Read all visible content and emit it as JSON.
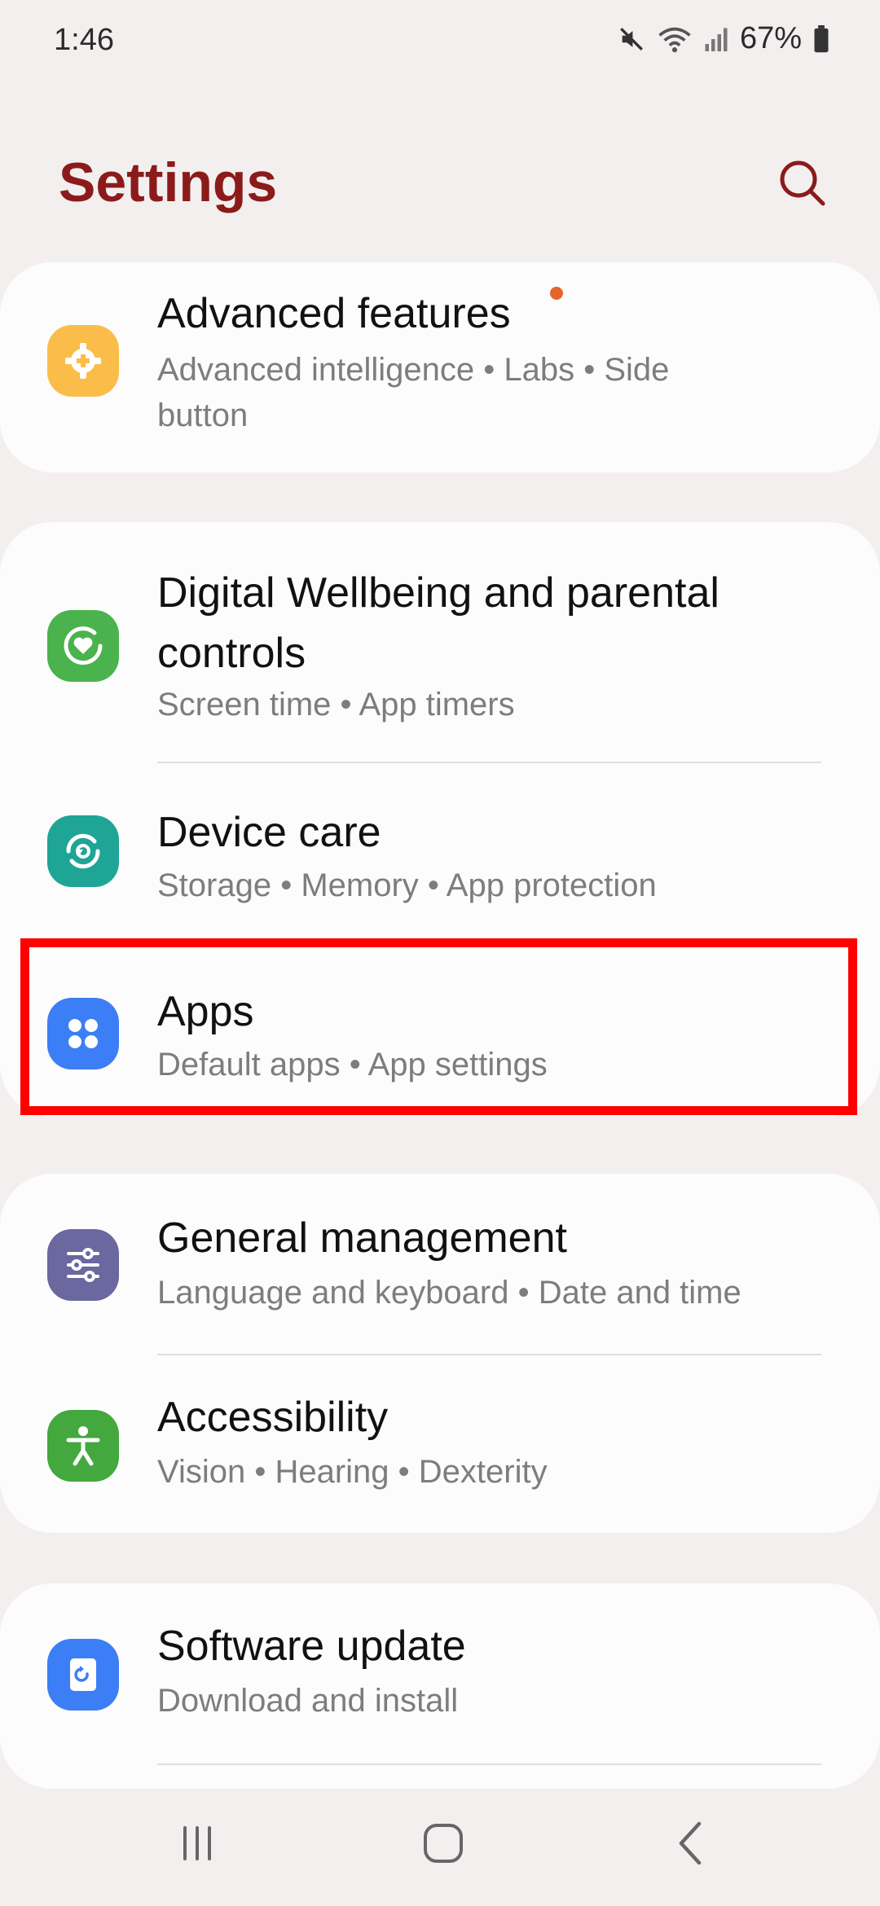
{
  "status_bar": {
    "time": "1:46",
    "battery": "67%",
    "icons": [
      "mute-icon",
      "wifi-icon",
      "signal-icon",
      "battery-icon"
    ]
  },
  "header": {
    "title": "Settings",
    "search_icon": "search-icon"
  },
  "colors": {
    "title": "#8b1b1b",
    "advanced_features_icon": "#fbbd4a",
    "digital_wellbeing_icon": "#4ab34d",
    "device_care_icon": "#1fa596",
    "apps_icon": "#3c7ef5",
    "general_management_icon": "#6b679f",
    "accessibility_icon": "#43a83e",
    "software_update_icon": "#3c7ef5",
    "notification_dot": "#e8642a",
    "highlight": "#ff0000"
  },
  "items": {
    "advanced_features": {
      "title": "Advanced features",
      "subtitle_line1": "Advanced intelligence  •  Labs  •  Side",
      "subtitle_line2": "button",
      "icon": "gear-plus-icon"
    },
    "digital_wellbeing": {
      "title_line1": "Digital Wellbeing and parental",
      "title_line2": "controls",
      "subtitle": "Screen time  •  App timers",
      "icon": "wellbeing-heart-icon"
    },
    "device_care": {
      "title": "Device care",
      "subtitle": "Storage  •  Memory  •  App protection",
      "icon": "device-care-icon"
    },
    "apps": {
      "title": "Apps",
      "subtitle": "Default apps  •  App settings",
      "icon": "apps-grid-icon"
    },
    "general_management": {
      "title": "General management",
      "subtitle": "Language and keyboard  •  Date and time",
      "icon": "sliders-icon"
    },
    "accessibility": {
      "title": "Accessibility",
      "subtitle": "Vision  •  Hearing  •  Dexterity",
      "icon": "accessibility-person-icon"
    },
    "software_update": {
      "title": "Software update",
      "subtitle": "Download and install",
      "icon": "software-update-icon"
    }
  },
  "nav_bar": {
    "buttons": [
      "recents-icon",
      "home-icon",
      "back-icon"
    ]
  }
}
